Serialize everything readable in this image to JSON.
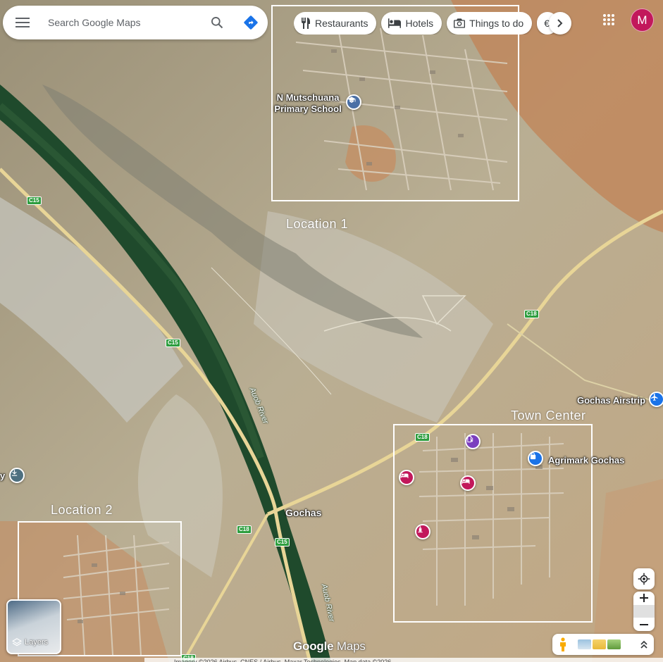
{
  "search": {
    "placeholder": "Search Google Maps"
  },
  "chips": [
    {
      "label": "Restaurants",
      "icon": "fork-knife-icon"
    },
    {
      "label": "Hotels",
      "icon": "bed-icon"
    },
    {
      "label": "Things to do",
      "icon": "camera-icon"
    }
  ],
  "account": {
    "initial": "M",
    "color": "#c2185b"
  },
  "map": {
    "places": {
      "gochas": "Gochas"
    },
    "pois": {
      "school": "N Mutschuana Primary School",
      "airstrip": "Gochas Airstrip",
      "agrimark": "Agrimark Gochas",
      "partial": "y"
    },
    "rivers": {
      "upper": "Auob River",
      "lower": "Auob River"
    },
    "roads": [
      "C15",
      "C15",
      "C18",
      "C18",
      "C18",
      "C15",
      "C18"
    ],
    "annotations": {
      "location1": "Location  1",
      "location2": "Location 2",
      "town_center": "Town Center"
    }
  },
  "controls": {
    "layers_label": "Layers"
  },
  "branding": {
    "logo_google": "Google",
    "logo_maps": "Maps"
  },
  "footer": {
    "attribution": "Imagery ©2026 Airbus, CNES / Airbus, Maxar Technologies, Map data ©2026"
  },
  "colors": {
    "accent": "#1a73e8",
    "school_pin": "#4a6fa5",
    "hotel_pin": "#c2185b",
    "airstrip_pin": "#1a73e8",
    "road": "#efd98c"
  }
}
